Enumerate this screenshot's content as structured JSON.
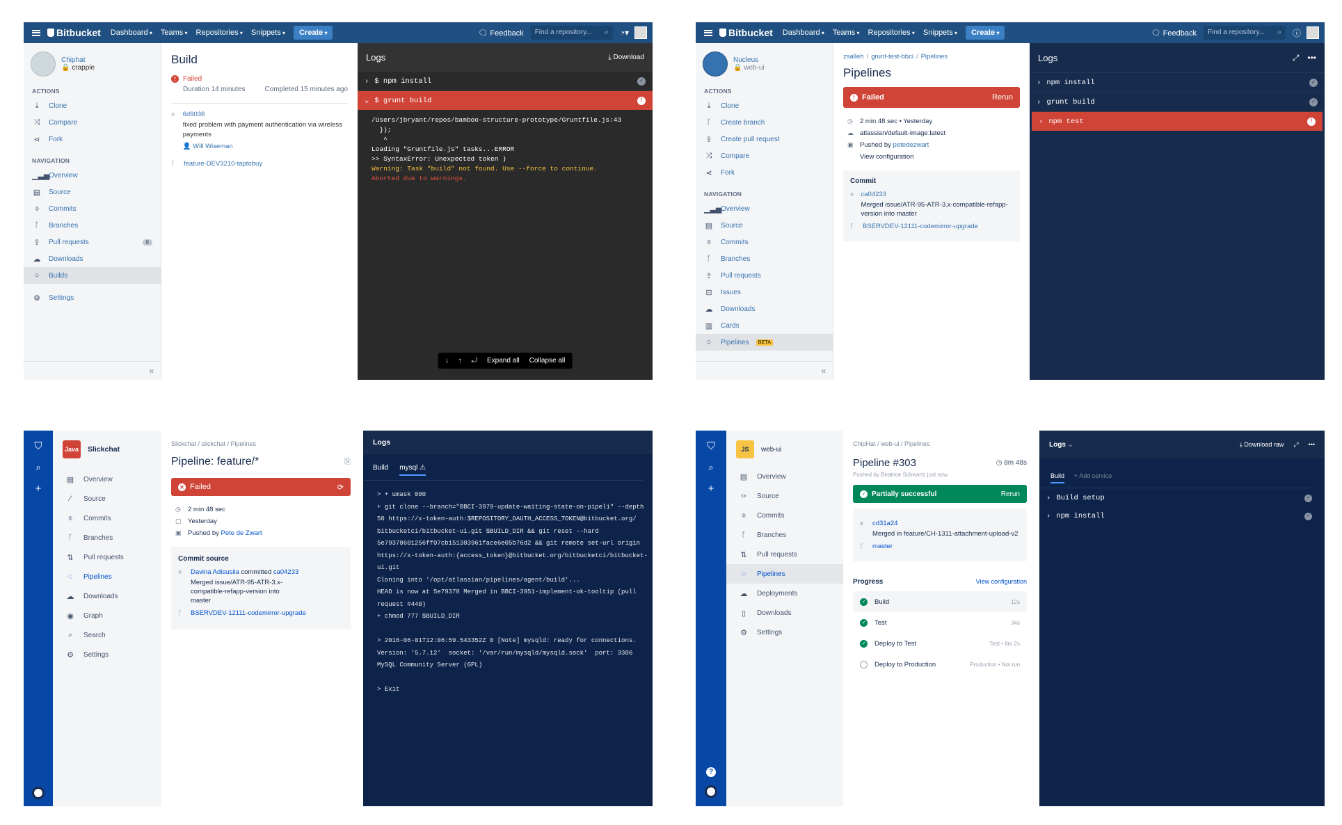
{
  "topbar": {
    "brand": "Bitbucket",
    "nav": [
      "Dashboard",
      "Teams",
      "Repositories",
      "Snippets"
    ],
    "create": "Create",
    "feedback": "Feedback",
    "search_placeholder": "Find a repository..."
  },
  "p1": {
    "repo_name": "Chiphat",
    "repo_owner": "crappie",
    "actions_header": "ACTIONS",
    "actions": [
      "Clone",
      "Compare",
      "Fork"
    ],
    "nav_header": "NAVIGATION",
    "nav": [
      "Overview",
      "Source",
      "Commits",
      "Branches",
      "Pull requests",
      "Downloads",
      "Builds"
    ],
    "pr_count": "9",
    "settings": "Settings",
    "collapse": "«",
    "build_title": "Build",
    "status": "Failed",
    "duration": "Duration 14 minutes",
    "completed": "Completed 15 minutes ago",
    "commit_hash": "6d9036",
    "commit_msg": "fixed problem with payment authentication via wireless payments",
    "author": "Will Wiseman",
    "branch": "feature-DEV3210-taptobuy",
    "logs_title": "Logs",
    "download": "Download",
    "steps": [
      "$ npm install",
      "$ grunt build"
    ],
    "output_lines": [
      "/Users/jbryant/repos/bamboo-structure-prototype/Gruntfile.js:43",
      "  });",
      "   ^",
      "Loading \"Gruntfile.js\" tasks...ERROR",
      ">> SyntaxError: Unexpected token )"
    ],
    "warning_line": "Warning: Task \"build\" not found. Use --force to continue.",
    "abort_line": "Aborted due to warnings.",
    "expand_all": "Expand all",
    "collapse_all": "Collapse all"
  },
  "p2": {
    "repo_name": "Nucleus",
    "repo_owner": "web-ui",
    "actions_header": "ACTIONS",
    "actions": [
      "Clone",
      "Create branch",
      "Create pull request",
      "Compare",
      "Fork"
    ],
    "nav_header": "NAVIGATION",
    "nav": [
      "Overview",
      "Source",
      "Commits",
      "Branches",
      "Pull requests",
      "Issues",
      "Downloads",
      "Cards",
      "Pipelines"
    ],
    "beta": "BETA",
    "collapse": "«",
    "breadcrumb": [
      "zsalleh",
      "grunt-test-bbci",
      "Pipelines"
    ],
    "title": "Pipelines",
    "status": "Failed",
    "rerun": "Rerun",
    "duration": "2 min 48 sec",
    "when": "Yesterday",
    "image": "atlassian/default-image:latest",
    "pushed_by_label": "Pushed by",
    "pushed_by": "petedezwart",
    "view_config": "View configuration",
    "commit_header": "Commit",
    "commit_hash": "ca04233",
    "commit_msg": "Merged issue/ATR-95-ATR-3.x-compatible-refapp-version into master",
    "branch": "BSERVDEV-12111-codemirror-upgrade",
    "logs_title": "Logs",
    "steps": [
      "npm install",
      "grunt build",
      "npm test"
    ]
  },
  "p3": {
    "lang": "Java",
    "repo": "Slickchat",
    "nav": [
      "Overview",
      "Source",
      "Commits",
      "Branches",
      "Pull requests",
      "Pipelines",
      "Downloads",
      "Graph",
      "Search",
      "Settings"
    ],
    "breadcrumb": "Slickchat / slickchat / Pipelines",
    "title": "Pipeline: feature/*",
    "status": "Failed",
    "duration": "2 min 48 sec",
    "when": "Yesterday",
    "pushed_by_label": "Pushed by",
    "pushed_by": "Pete de Zwart",
    "commit_source": "Commit source",
    "committer": "Davina Adisusila",
    "committed": "committed",
    "commit_hash": "ca04233",
    "commit_msg": "Merged issue/ATR-95-ATR-3.x-compatible-refapp-version into master",
    "branch": "BSERVDEV-12111-codemirror-upgrade",
    "logs_title": "Logs",
    "tabs": [
      "Build",
      "mysql ⚠"
    ],
    "log": "> + umask 000\n+ git clone --branch=\"BBCI-3979-update-waiting-state-on-pipeli\" --depth\n50 https://x-token-auth:$REPOSITORY_OAUTH_ACCESS_TOKEN@bitbucket.org/\nbitbucketci/bitbucket-ui.git $BUILD_DIR && git reset --hard\n5e79378601256ff07cb151383961face6e05b76d2 && git remote set-url origin\nhttps://x-token-auth:{access_token}@bitbucket.org/bitbucketci/bitbucket-\nui.git\nCloning into '/opt/atlassian/pipelines/agent/build'...\nHEAD is now at 5e79378 Merged in BBCI-3951-implement-ok-tooltip (pull\nrequest #440)\n+ chmod 777 $BUILD_DIR\n\n> 2016-06-01T12:06:59.543352Z 0 [Note] mysqld: ready for connections.\nVersion: '5.7.12'  socket: '/var/run/mysqld/mysqld.sock'  port: 3306\nMySQL Community Server (GPL)\n\n> Exit"
  },
  "p4": {
    "lang": "JS",
    "repo": "web-ui",
    "nav": [
      "Overview",
      "Source",
      "Commits",
      "Branches",
      "Pull requests",
      "Pipelines",
      "Deployments",
      "Downloads",
      "Settings"
    ],
    "breadcrumb": "ChipHat / web-ui / Pipelines",
    "title": "Pipeline #303",
    "duration": "8m 48s",
    "pushed_by": "Pushed by  Beatrice Schwartz just now",
    "status": "Partially successful",
    "rerun": "Rerun",
    "commit_hash": "cd31a24",
    "commit_msg": "Merged in feature/CH-1311-attachment-upload-v2",
    "branch": "master",
    "progress": "Progress",
    "view_config": "View configuration",
    "steps": [
      {
        "name": "Build",
        "meta": "12s"
      },
      {
        "name": "Test",
        "meta": "34s"
      },
      {
        "name": "Deploy to Test",
        "meta": "Test  •  8m 2s"
      },
      {
        "name": "Deploy to Production",
        "meta": "Production  •  Not run"
      }
    ],
    "logs_title": "Logs",
    "download_raw": "Download raw",
    "tab_build": "Build",
    "add_service": "+ Add service",
    "log_steps": [
      "Build setup",
      "npm install"
    ]
  }
}
